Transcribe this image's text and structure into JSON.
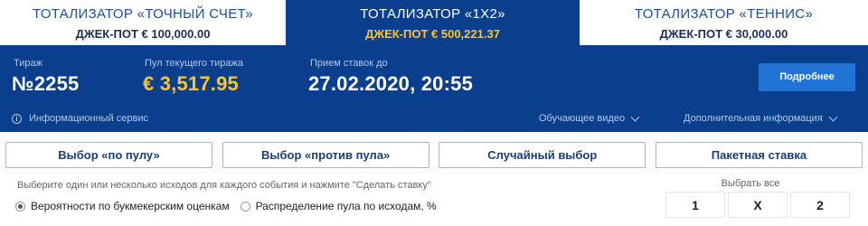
{
  "tabs": [
    {
      "title": "ТОТАЛИЗАТОР «ТОЧНЫЙ СЧЕТ»",
      "jackpot": "ДЖЕК-ПОТ € 100,000.00"
    },
    {
      "title": "ТОТАЛИЗАТОР «1Х2»",
      "jackpot": "ДЖЕК-ПОТ € 500,221.37"
    },
    {
      "title": "ТОТАЛИЗАТОР «ТЕННИС»",
      "jackpot": "ДЖЕК-ПОТ € 30,000.00"
    }
  ],
  "panel": {
    "draw_label": "Тираж",
    "draw_value": "№2255",
    "pool_label": "Пул текущего тиража",
    "pool_value": "€ 3,517.95",
    "deadline_label": "Прием ставок до",
    "deadline_value": "27.02.2020, 20:55",
    "more_button": "Подробнее",
    "info_service": "Информационный сервис",
    "video_link": "Обучающее видео",
    "more_info_link": "Дополнительная информация"
  },
  "selection_buttons": [
    "Выбор «по пулу»",
    "Выбор «против пула»",
    "Случайный выбор",
    "Пакетная ставка"
  ],
  "hint": "Выберите один или несколько исходов для каждого события и нажмите \"Сделать ставку\"",
  "select_all": "Выбрать все",
  "radios": [
    {
      "label": "Вероятности по букмекерским оценкам",
      "checked": true
    },
    {
      "label": "Распределение пула по исходам, %",
      "checked": false
    }
  ],
  "outcomes": [
    "1",
    "X",
    "2"
  ],
  "colors": {
    "brand_blue": "#0a3f8e",
    "gold": "#ffc527",
    "button_blue": "#1f74d6"
  }
}
